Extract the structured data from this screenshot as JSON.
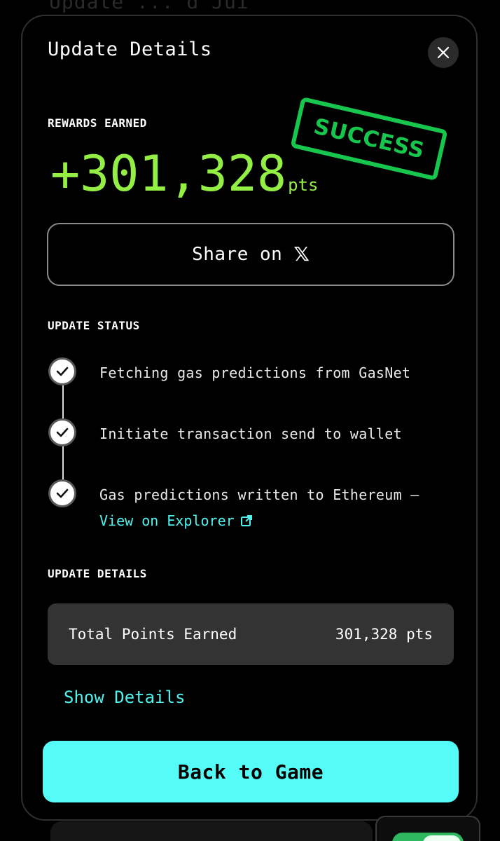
{
  "background": {
    "partial_text": "Update ... d Jui"
  },
  "modal": {
    "title": "Update Details",
    "close_icon": "close-icon",
    "rewards": {
      "label": "REWARDS EARNED",
      "value": "+301,328",
      "unit": "pts"
    },
    "stamp": {
      "text": "SUCCESS",
      "color": "#17c64d"
    },
    "share": {
      "label": "Share on",
      "icon": "x-logo-icon",
      "icon_glyph": "𝕏"
    },
    "status": {
      "label": "UPDATE STATUS",
      "steps": [
        {
          "text": "Fetching gas predictions from GasNet",
          "icon": "check-icon",
          "done": true
        },
        {
          "text": "Initiate transaction send to wallet",
          "icon": "check-icon",
          "done": true
        },
        {
          "text": "Gas predictions written to Ethereum —",
          "icon": "check-icon",
          "done": true
        }
      ],
      "explorer_link": "View on Explorer",
      "explorer_icon": "external-link-icon"
    },
    "details": {
      "label": "UPDATE DETAILS",
      "row_label": "Total Points Earned",
      "row_value": "301,328 pts",
      "show_details": "Show Details"
    },
    "back_button": "Back to Game"
  },
  "colors": {
    "points_green": "#94ef45",
    "accent_cyan": "#55fbf7",
    "link_cyan": "#4ff3f0",
    "card_bg": "#333333"
  }
}
